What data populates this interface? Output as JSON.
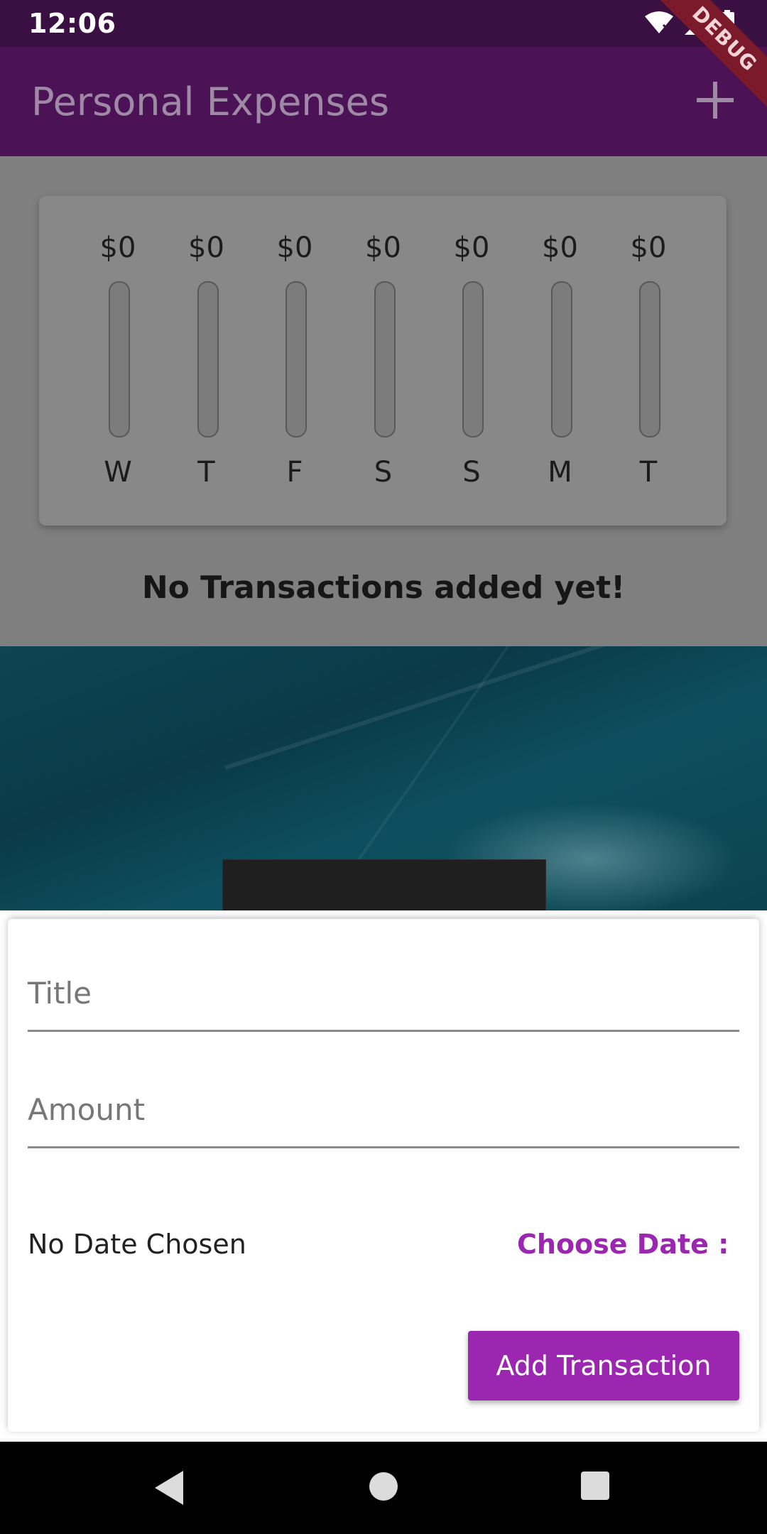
{
  "status_bar": {
    "time": "12:06",
    "icons": [
      "wifi-icon",
      "signal-icon",
      "battery-icon"
    ]
  },
  "app_bar": {
    "title": "Personal Expenses",
    "add_icon": "plus-icon",
    "debug_banner": "DEBUG"
  },
  "colors": {
    "primary": "#4b1255",
    "accent": "#9b27b0"
  },
  "chart_data": {
    "type": "bar",
    "categories": [
      "W",
      "T",
      "F",
      "S",
      "S",
      "M",
      "T"
    ],
    "labels": [
      "$0",
      "$0",
      "$0",
      "$0",
      "$0",
      "$0",
      "$0"
    ],
    "values": [
      0,
      0,
      0,
      0,
      0,
      0,
      0
    ]
  },
  "empty_state": {
    "message": "No Transactions added yet!"
  },
  "form": {
    "title_placeholder": "Title",
    "amount_placeholder": "Amount",
    "date_text": "No Date Chosen",
    "choose_date_label": "Choose Date :",
    "submit_label": "Add Transaction"
  },
  "nav_bar": {
    "icons": [
      "back-icon",
      "home-icon",
      "recents-icon"
    ]
  }
}
